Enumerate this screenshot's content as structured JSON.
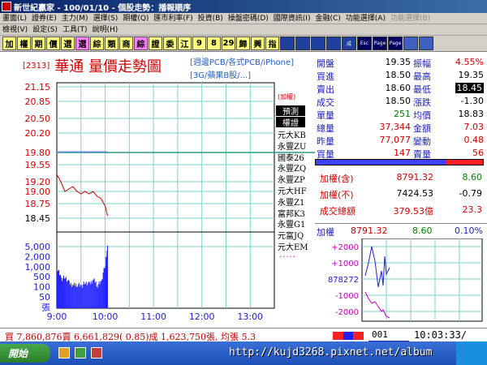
{
  "window": {
    "title": "新世紀贏家 - 100/01/10 - 個股走勢：播報順序"
  },
  "menu1": [
    {
      "label": "畫面(L)",
      "dim": false
    },
    {
      "label": "證券(E)",
      "dim": false
    },
    {
      "label": "主力(M)",
      "dim": false
    },
    {
      "label": "選擇(S)",
      "dim": false
    },
    {
      "label": "期權(Q)",
      "dim": false
    },
    {
      "label": "匯市利率(F)",
      "dim": false
    },
    {
      "label": "投資(B)",
      "dim": false
    },
    {
      "label": "操盤密碼(D)",
      "dim": false
    },
    {
      "label": "國際資訊(I)",
      "dim": false
    },
    {
      "label": "金融(C)",
      "dim": false
    },
    {
      "label": "功能選擇(A)",
      "dim": false
    },
    {
      "label": "功能選擇(B)",
      "dim": true
    }
  ],
  "menu2": [
    {
      "label": "檢視(V)"
    },
    {
      "label": "設定(S)"
    },
    {
      "label": "工具(T)"
    },
    {
      "label": "說明(H)"
    }
  ],
  "toolbar": {
    "buttons": [
      {
        "label": "加",
        "bg": "#ffff80"
      },
      {
        "label": "權",
        "bg": "#ffff80"
      },
      {
        "label": "期",
        "bg": "#ffff80"
      },
      {
        "label": "價",
        "bg": "#ffff80"
      },
      {
        "label": "選",
        "bg": "#ffff80"
      },
      {
        "label": "選",
        "bg": "#ff80ff"
      },
      {
        "label": "綜",
        "bg": "#ffff80"
      },
      {
        "label": "類",
        "bg": "#ffff80"
      },
      {
        "label": "商",
        "bg": "#ffff80"
      },
      {
        "label": "綜",
        "bg": "#ff80ff"
      },
      {
        "label": "證",
        "bg": "#ffff80"
      },
      {
        "label": "委",
        "bg": "#ffff80"
      },
      {
        "label": "江",
        "bg": "#ffff80"
      },
      {
        "label": "9",
        "bg": "#ffff80"
      },
      {
        "label": "8",
        "bg": "#ffff80"
      },
      {
        "label": "29",
        "bg": "#ffff80"
      },
      {
        "label": "歸",
        "bg": "#ffff80"
      },
      {
        "label": "興",
        "bg": "#ffff80"
      },
      {
        "label": "指",
        "bg": "#ffff80"
      }
    ],
    "squares": [
      {
        "label": "",
        "bg": "#2040a0"
      },
      {
        "label": "",
        "bg": "#2040a0"
      },
      {
        "label": "",
        "bg": "#2040a0"
      },
      {
        "label": "",
        "bg": "#2040a0"
      },
      {
        "label": "成",
        "bg": "#2040a0"
      },
      {
        "label": "Esc",
        "bg": "#000060"
      },
      {
        "label": "Page",
        "bg": "#000060"
      },
      {
        "label": "Page",
        "bg": "#000060"
      },
      {
        "label": "",
        "bg": "#4060c0"
      },
      {
        "label": "",
        "bg": "#4060c0"
      }
    ]
  },
  "chart": {
    "code": "[2313]",
    "title": "華通  量價走勢圖",
    "tag1": "[週邊PCB/各式PCB/iPhone]",
    "tag2": "[3G/蘋果B股/...]",
    "price_ticks": [
      "21.15",
      "20.85",
      "20.50",
      "20.20",
      "19.80",
      "19.55",
      "19.20",
      "19.00",
      "18.75",
      "18.45"
    ],
    "volume_ticks": [
      "5,000",
      "2,000",
      "1,000",
      "500",
      "100",
      "50",
      "張"
    ],
    "time_ticks": [
      "9:00",
      "10:00",
      "11:00",
      "12:00",
      "13:00"
    ]
  },
  "chart_data": {
    "type": "line",
    "title": "華通  量價走勢圖",
    "xlabel": "",
    "ylabel": "",
    "x_range": [
      "9:00",
      "13:30"
    ],
    "ylim": [
      18.45,
      21.15
    ],
    "reference_price": 19.8,
    "series": [
      {
        "name": "",
        "x": [
          "9:00",
          "9:05",
          "9:10",
          "9:15",
          "9:20",
          "9:25",
          "9:30",
          "9:35",
          "9:40",
          "9:45",
          "9:50",
          "9:55",
          "10:00",
          "10:03"
        ],
        "values": [
          19.35,
          19.2,
          19.0,
          19.05,
          19.1,
          19.0,
          18.95,
          19.0,
          18.95,
          19.0,
          18.9,
          18.85,
          18.7,
          18.5
        ]
      }
    ],
    "volume": {
      "x": [
        "9:00",
        "9:05",
        "9:10",
        "9:15",
        "9:20",
        "9:25",
        "9:30",
        "9:35",
        "9:40",
        "9:45",
        "9:50",
        "9:55",
        "10:00",
        "10:03"
      ],
      "values": [
        900,
        450,
        500,
        320,
        280,
        300,
        260,
        340,
        300,
        420,
        280,
        360,
        1200,
        5000
      ]
    }
  },
  "brokers": {
    "unit": "(加權)",
    "head1": "預測",
    "head2": "權證",
    "items": [
      "元大KB",
      "永豐ZU",
      "國泰26",
      "永豐ZQ",
      "永豐ZP",
      "元大HF",
      "永豐Z1",
      "富邦K3",
      "永豐G1",
      "元富JQ",
      "元大EM"
    ],
    "more": "....."
  },
  "quote": {
    "rows": [
      {
        "l1": "開盤",
        "v1": "19.35",
        "c1": "black",
        "l2": "振幅",
        "v2": "4.55%",
        "c2": "red",
        "hl2": false
      },
      {
        "l1": "買進",
        "v1": "18.50",
        "c1": "black",
        "l2": "最高",
        "v2": "19.35",
        "c2": "black",
        "hl2": false
      },
      {
        "l1": "賣出",
        "v1": "18.60",
        "c1": "black",
        "l2": "最低",
        "v2": "18.45",
        "c2": "black",
        "hl2": true
      },
      {
        "l1": "成交",
        "v1": "18.50",
        "c1": "black",
        "l2": "漲跌",
        "v2": "-1.30",
        "c2": "black",
        "hl2": false
      },
      {
        "l1": "單量",
        "v1": "251",
        "c1": "green",
        "l2": "均價",
        "v2": "18.83",
        "c2": "black",
        "hl2": false
      },
      {
        "l1": "總量",
        "v1": "37,344",
        "c1": "red",
        "l2": "金額",
        "v2": "7.03",
        "c2": "red",
        "hl2": false
      },
      {
        "l1": "昨量",
        "v1": "77,077",
        "c1": "red",
        "l2": "變動",
        "v2": "0.48",
        "c2": "red",
        "hl2": false
      },
      {
        "l1": "買量",
        "v1": "147",
        "c1": "red",
        "l2": "賣量",
        "v2": "56",
        "c2": "red",
        "hl2": false
      }
    ],
    "ratio_buy_color": "#4040ff",
    "ratio_sell_color": "#ff2020",
    "ratio_buy": 0.78
  },
  "index": {
    "rows": [
      {
        "label": "加權(含)",
        "v1": "8791.32",
        "c1": "red",
        "v2": "8.60",
        "c2": "green"
      },
      {
        "label": "加權(不)",
        "v1": "7424.53",
        "c1": "black",
        "v2": "-0.79",
        "c2": "black"
      },
      {
        "label": "成交總額",
        "v1": "379.53億",
        "c1": "red",
        "v2": "23.3",
        "c2": "red"
      }
    ]
  },
  "mini": {
    "label": "加權",
    "v1": "8791.32",
    "v2": "8.60",
    "v3": "0.10%",
    "ticks": [
      "+2000",
      "+1000",
      "878272",
      "-1000",
      "-2000"
    ]
  },
  "status": {
    "text": "買 7,860,876賣 6,661,829( 0.85)成 1,623,750張, 均張 5.3",
    "page": "001",
    "clock": "10:03:33/"
  },
  "taskbar": {
    "start": "開始",
    "watermark": "http://kujd3268.pixnet.net/album"
  }
}
